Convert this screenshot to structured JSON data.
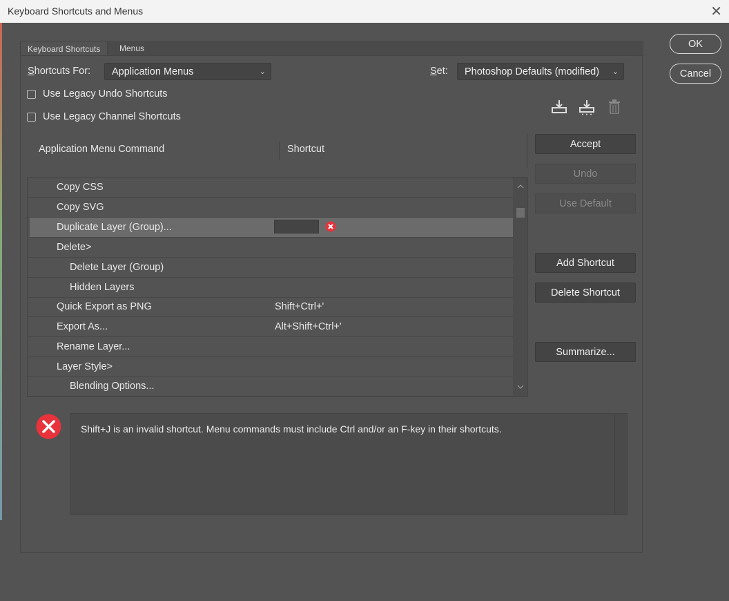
{
  "window": {
    "title": "Keyboard Shortcuts and Menus",
    "close_glyph": "✕"
  },
  "tabs": [
    {
      "label": "Keyboard Shortcuts"
    },
    {
      "label": "Menus"
    }
  ],
  "shortcuts_for": {
    "label": "Shortcuts For:",
    "value": "Application Menus"
  },
  "set": {
    "label": "Set:",
    "value": "Photoshop Defaults (modified)"
  },
  "checkboxes": [
    {
      "label": "Use Legacy Undo Shortcuts",
      "checked": false
    },
    {
      "label": "Use Legacy Channel Shortcuts",
      "checked": false
    }
  ],
  "icons": {
    "save": "save-set-icon",
    "save_as": "save-set-as-icon",
    "delete": "delete-set-icon"
  },
  "columns": {
    "command": "Application Menu Command",
    "shortcut": "Shortcut"
  },
  "rows": [
    {
      "command": "Copy CSS",
      "shortcut": "",
      "indent": 1
    },
    {
      "command": "Copy SVG",
      "shortcut": "",
      "indent": 1
    },
    {
      "command": "Duplicate Layer (Group)...",
      "shortcut": "",
      "indent": 1,
      "selected": true,
      "editing": true
    },
    {
      "command": "Delete>",
      "shortcut": "",
      "indent": 1
    },
    {
      "command": "Delete Layer (Group)",
      "shortcut": "",
      "indent": 2
    },
    {
      "command": "Hidden Layers",
      "shortcut": "",
      "indent": 2
    },
    {
      "command": "Quick Export as PNG",
      "shortcut": "Shift+Ctrl+'",
      "indent": 1
    },
    {
      "command": "Export As...",
      "shortcut": "Alt+Shift+Ctrl+'",
      "indent": 1
    },
    {
      "command": "Rename Layer...",
      "shortcut": "",
      "indent": 1
    },
    {
      "command": "Layer Style>",
      "shortcut": "",
      "indent": 1
    },
    {
      "command": "Blending Options...",
      "shortcut": "",
      "indent": 2
    }
  ],
  "buttons": {
    "ok": "OK",
    "cancel": "Cancel",
    "accept": "Accept",
    "undo": "Undo",
    "use_default": "Use Default",
    "add_shortcut": "Add Shortcut",
    "delete_shortcut": "Delete Shortcut",
    "summarize": "Summarize..."
  },
  "error": {
    "message": "Shift+J is an invalid shortcut.  Menu commands must include Ctrl and/or an F-key in their shortcuts."
  },
  "colors": {
    "background": "#535353",
    "error_red": "#e8323c"
  }
}
